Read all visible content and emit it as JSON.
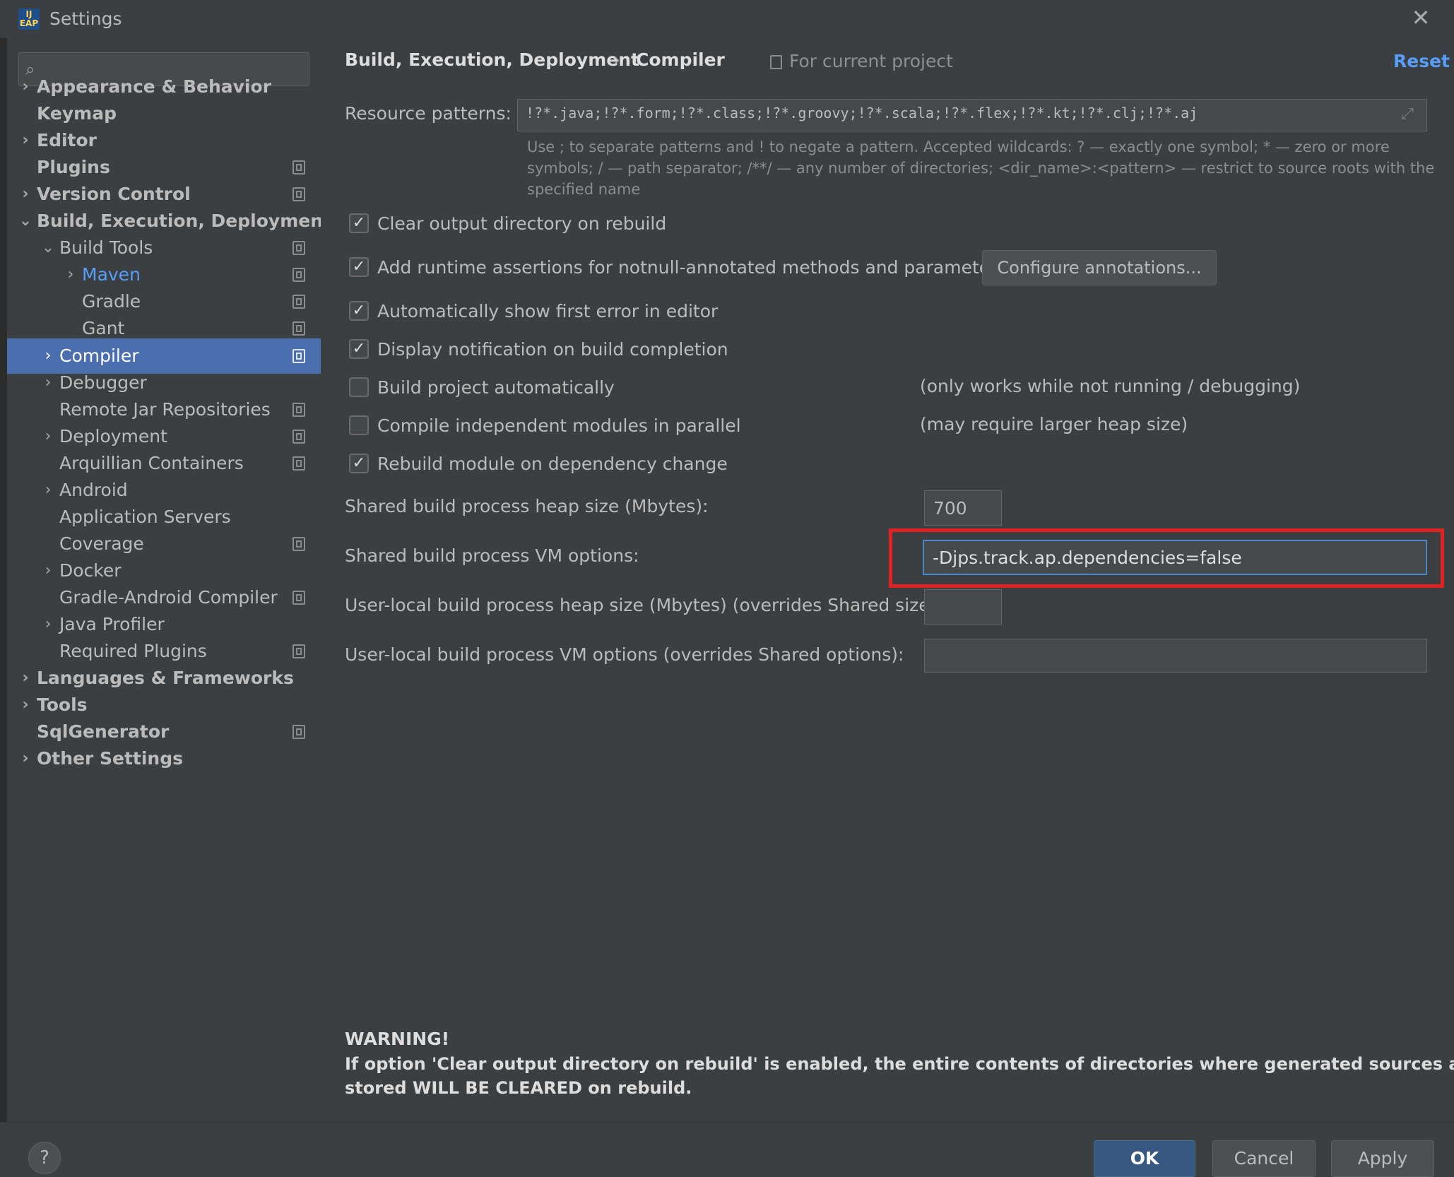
{
  "window": {
    "title": "Settings",
    "icon_text": "IJ EAP",
    "close_glyph": "✕"
  },
  "search": {
    "icon": "search-icon",
    "placeholder": ""
  },
  "sidebar": {
    "items": [
      {
        "label": "Appearance & Behavior",
        "arrow": "›"
      },
      {
        "label": "Keymap"
      },
      {
        "label": "Editor",
        "arrow": "›"
      },
      {
        "label": "Plugins"
      },
      {
        "label": "Version Control",
        "arrow": "›"
      },
      {
        "label": "Build, Execution, Deployment",
        "arrow": "⌄"
      },
      {
        "label": "Build Tools",
        "arrow": "⌄"
      },
      {
        "label": "Maven",
        "arrow": "›"
      },
      {
        "label": "Gradle"
      },
      {
        "label": "Gant"
      },
      {
        "label": "Compiler",
        "arrow": "›"
      },
      {
        "label": "Debugger",
        "arrow": "›"
      },
      {
        "label": "Remote Jar Repositories"
      },
      {
        "label": "Deployment",
        "arrow": "›"
      },
      {
        "label": "Arquillian Containers"
      },
      {
        "label": "Android",
        "arrow": "›"
      },
      {
        "label": "Application Servers"
      },
      {
        "label": "Coverage"
      },
      {
        "label": "Docker",
        "arrow": "›"
      },
      {
        "label": "Gradle-Android Compiler"
      },
      {
        "label": "Java Profiler",
        "arrow": "›"
      },
      {
        "label": "Required Plugins"
      },
      {
        "label": "Languages & Frameworks",
        "arrow": "›"
      },
      {
        "label": "Tools",
        "arrow": "›"
      },
      {
        "label": "SqlGenerator"
      },
      {
        "label": "Other Settings",
        "arrow": "›"
      }
    ]
  },
  "header": {
    "breadcrumb_parent": "Build, Execution, Deployment",
    "breadcrumb_sep": "›",
    "breadcrumb_current": "Compiler",
    "scope_label": "For current project",
    "reset_label": "Reset"
  },
  "resource": {
    "label": "Resource patterns:",
    "value": "!?*.java;!?*.form;!?*.class;!?*.groovy;!?*.scala;!?*.flex;!?*.kt;!?*.clj;!?*.aj",
    "expand_glyph": "⤢",
    "hint_lines": [
      "Use ; to separate patterns and ! to negate a pattern. Accepted wildcards: ? — exactly one symbol; * — zero or more",
      "symbols; / — path separator; /**/ — any number of directories; <dir_name>:<pattern> — restrict to source roots with the",
      "specified name"
    ]
  },
  "options": [
    {
      "label": "Clear output directory on rebuild",
      "checked": true
    },
    {
      "label": "Add runtime assertions for notnull-annotated methods and parameters",
      "checked": true
    },
    {
      "label": "Automatically show first error in editor",
      "checked": true
    },
    {
      "label": "Display notification on build completion",
      "checked": true
    },
    {
      "label": "Build project automatically",
      "checked": false,
      "note": "(only works while not running / debugging)"
    },
    {
      "label": "Compile independent modules in parallel",
      "checked": false,
      "note": "(may require larger heap size)"
    },
    {
      "label": "Rebuild module on dependency change",
      "checked": true
    }
  ],
  "check_glyph": "✓",
  "configure_button": "Configure annotations...",
  "fields": {
    "shared_heap_label": "Shared build process heap size (Mbytes):",
    "shared_heap_value": "700",
    "shared_vm_label": "Shared build process VM options:",
    "shared_vm_value": "-Djps.track.ap.dependencies=false",
    "local_heap_label": "User-local build process heap size (Mbytes) (overrides Shared size):",
    "local_heap_value": "",
    "local_vm_label": "User-local build process VM options (overrides Shared options):",
    "local_vm_value": ""
  },
  "warning": {
    "title": "WARNING!",
    "line1": "If option 'Clear output directory on rebuild' is enabled, the entire contents of directories where generated sources are",
    "line2": "stored WILL BE CLEARED on rebuild."
  },
  "buttons": {
    "help": "?",
    "ok": "OK",
    "cancel": "Cancel",
    "apply": "Apply"
  },
  "colors": {
    "accent": "#4b6eaf",
    "link": "#589df6",
    "highlight": "#e02222",
    "background": "#3c3f41"
  }
}
